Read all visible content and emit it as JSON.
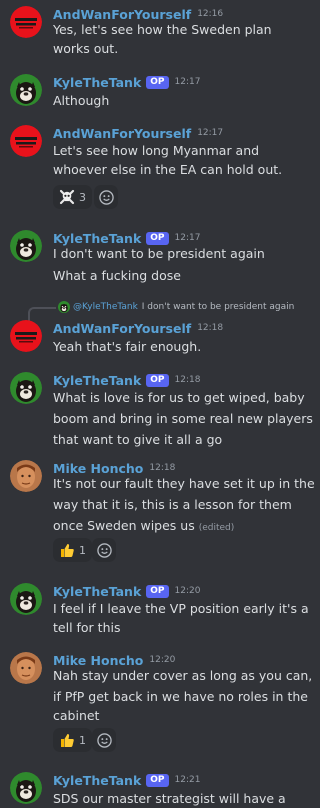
{
  "users": {
    "andwan": "AndWanForYourself",
    "kyle": "KyleTheTank",
    "mike": "Mike Honcho"
  },
  "op_badge": "OP",
  "edited_label": "(edited)",
  "colors": {
    "name": "#5aa2d6",
    "op_badge": "#5865f2",
    "bg": "#313338"
  },
  "messages": [
    {
      "time": "12:16",
      "lines": [
        "Yes, let's see how the Sweden plan",
        "works out."
      ]
    },
    {
      "time": "12:17",
      "lines": [
        "Although"
      ]
    },
    {
      "time": "12:17",
      "lines": [
        "Let's see how long Myanmar and",
        "whoever else in the EA can hold out."
      ],
      "reaction": {
        "icon": "skull-crossbones-emoji",
        "count": "3"
      }
    },
    {
      "time": "12:17",
      "lines": [
        "I don't want to be president again",
        "What a fucking dose"
      ]
    },
    {
      "time": "12:18",
      "lines": [
        "Yeah that's fair enough."
      ],
      "reply_to": {
        "name": "@KyleTheTank",
        "text": "I don't want to be president again"
      }
    },
    {
      "time": "12:18",
      "lines": [
        "What is love is for us to get wiped, baby",
        "boom and bring in some real new players",
        "that want to give it all a go"
      ]
    },
    {
      "time": "12:18",
      "lines": [
        "It's not our fault they have set it up in the",
        "way that it is, this is a lesson for them",
        "once Sweden wipes us"
      ],
      "reaction": {
        "icon": "thumbs-up-emoji",
        "count": "1"
      }
    },
    {
      "time": "12:20",
      "lines": [
        "I feel if I leave the VP position early it's a",
        "tell for this"
      ]
    },
    {
      "time": "12:20",
      "lines": [
        "Nah stay under cover as long as you can,",
        "if PfP get back in we have no roles in the",
        "cabinet"
      ],
      "reaction": {
        "icon": "thumbs-up-emoji",
        "count": "1"
      }
    },
    {
      "time": "12:21",
      "lines": [
        "SDS our master strategist will have a"
      ]
    }
  ]
}
